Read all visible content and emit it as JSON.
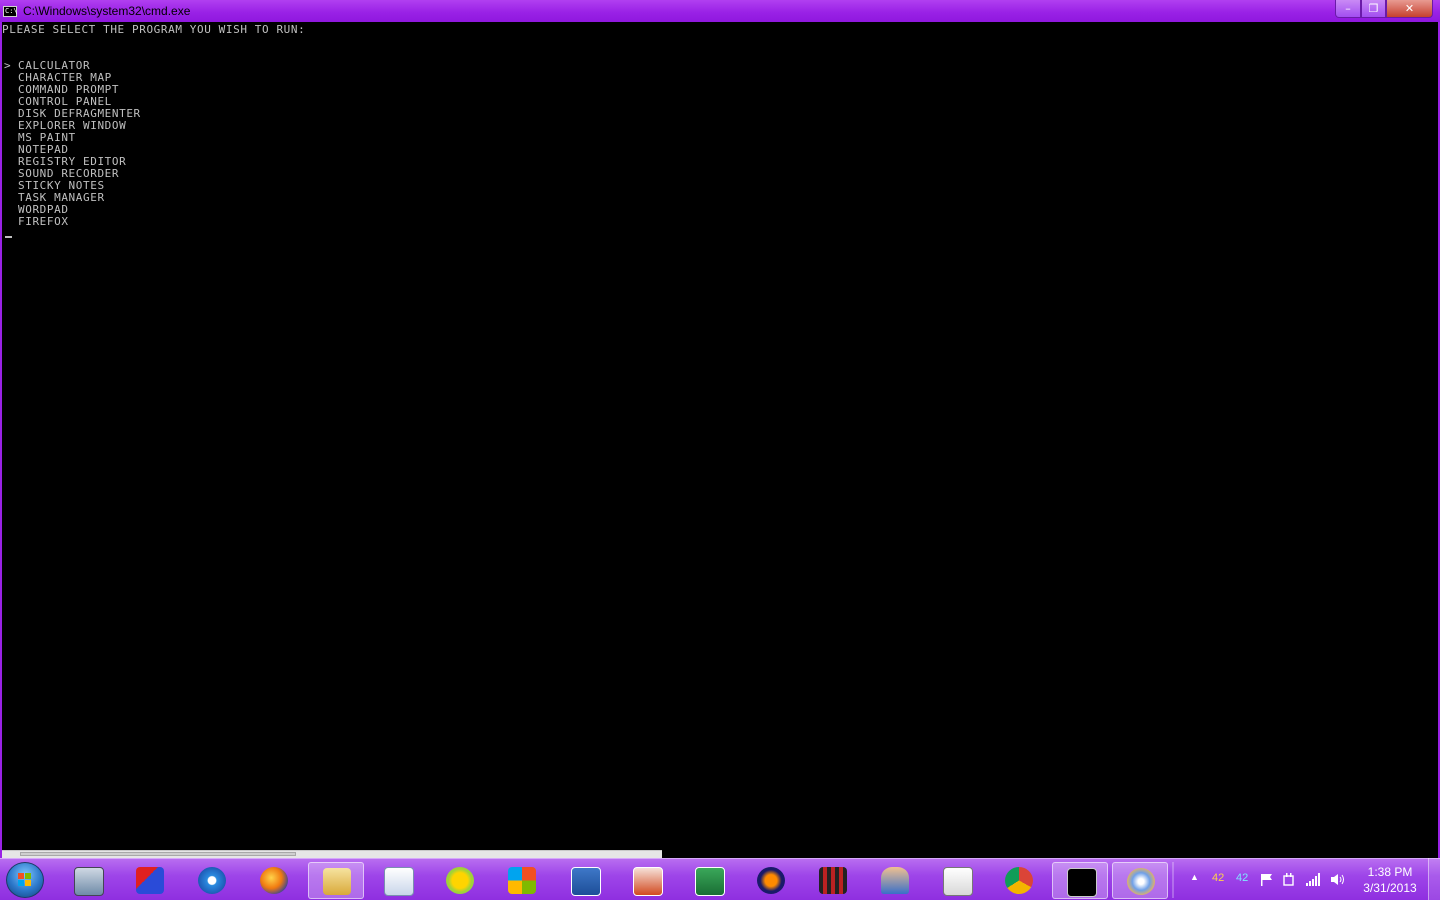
{
  "window": {
    "title": "C:\\Windows\\system32\\cmd.exe",
    "icon_text": "C:\\",
    "minimize": "–",
    "maximize": "❐",
    "close": "✕"
  },
  "console": {
    "prompt": "PLEASE SELECT THE PROGRAM YOU WISH TO RUN:",
    "selection_marker": ">",
    "items": [
      "CALCULATOR",
      "CHARACTER MAP",
      "COMMAND PROMPT",
      "CONTROL PANEL",
      "DISK DEFRAGMENTER",
      "EXPLORER WINDOW",
      "MS PAINT",
      "NOTEPAD",
      "REGISTRY EDITOR",
      "SOUND RECORDER",
      "STICKY NOTES",
      "TASK MANAGER",
      "WORDPAD",
      "FIREFOX"
    ],
    "selected_index": 0,
    "text_color": "#c0c0c0",
    "background": "#000000"
  },
  "taskbar": {
    "pinned": [
      {
        "name": "remote-desktop-icon"
      },
      {
        "name": "toy-app-icon"
      },
      {
        "name": "internet-explorer-icon"
      },
      {
        "name": "firefox-icon"
      },
      {
        "name": "windows-explorer-icon"
      },
      {
        "name": "media-player-icon"
      },
      {
        "name": "joinme-icon"
      },
      {
        "name": "windows-logo-app-icon"
      },
      {
        "name": "word-icon"
      },
      {
        "name": "powerpoint-icon"
      },
      {
        "name": "excel-icon"
      },
      {
        "name": "audacity-icon"
      },
      {
        "name": "movie-maker-icon"
      },
      {
        "name": "user-app-icon"
      },
      {
        "name": "solitaire-icon"
      },
      {
        "name": "chrome-icon"
      },
      {
        "name": "command-prompt-icon"
      },
      {
        "name": "paint-icon"
      }
    ],
    "active_index": 16
  },
  "tray": {
    "show_hidden": "▲",
    "temp1": "42",
    "temp2": "42",
    "time": "1:38 PM",
    "date": "3/31/2013"
  },
  "colors": {
    "accent": "#9a22e6",
    "taskbar": "#9e45e9"
  }
}
